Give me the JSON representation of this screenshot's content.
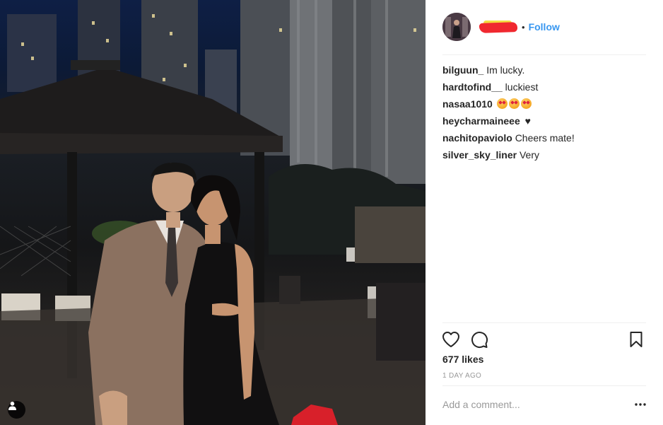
{
  "post": {
    "header": {
      "separator": "•",
      "follow_label": "Follow"
    },
    "comments": [
      {
        "user": "bilguun_",
        "text": "Im lucky."
      },
      {
        "user": "hardtofind__",
        "text": "luckiest"
      },
      {
        "user": "nasaa1010",
        "text": ""
      },
      {
        "user": "heycharmaineee",
        "text": "♥"
      },
      {
        "user": "nachitopaviolo",
        "text": "Cheers mate!"
      },
      {
        "user": "silver_sky_liner",
        "text": "Very"
      }
    ],
    "likes_text": "677 likes",
    "time_text": "1 DAY AGO",
    "comment_placeholder": "Add a comment...",
    "more_label": "•••"
  },
  "icons": {
    "like": "heart-outline-icon",
    "comment": "speech-bubble-icon",
    "save": "bookmark-icon",
    "more": "ellipsis-icon",
    "tag": "person-tag-icon"
  },
  "colors": {
    "accent": "#3897f0",
    "text": "#262626",
    "muted": "#999999",
    "divider": "#efefef"
  }
}
